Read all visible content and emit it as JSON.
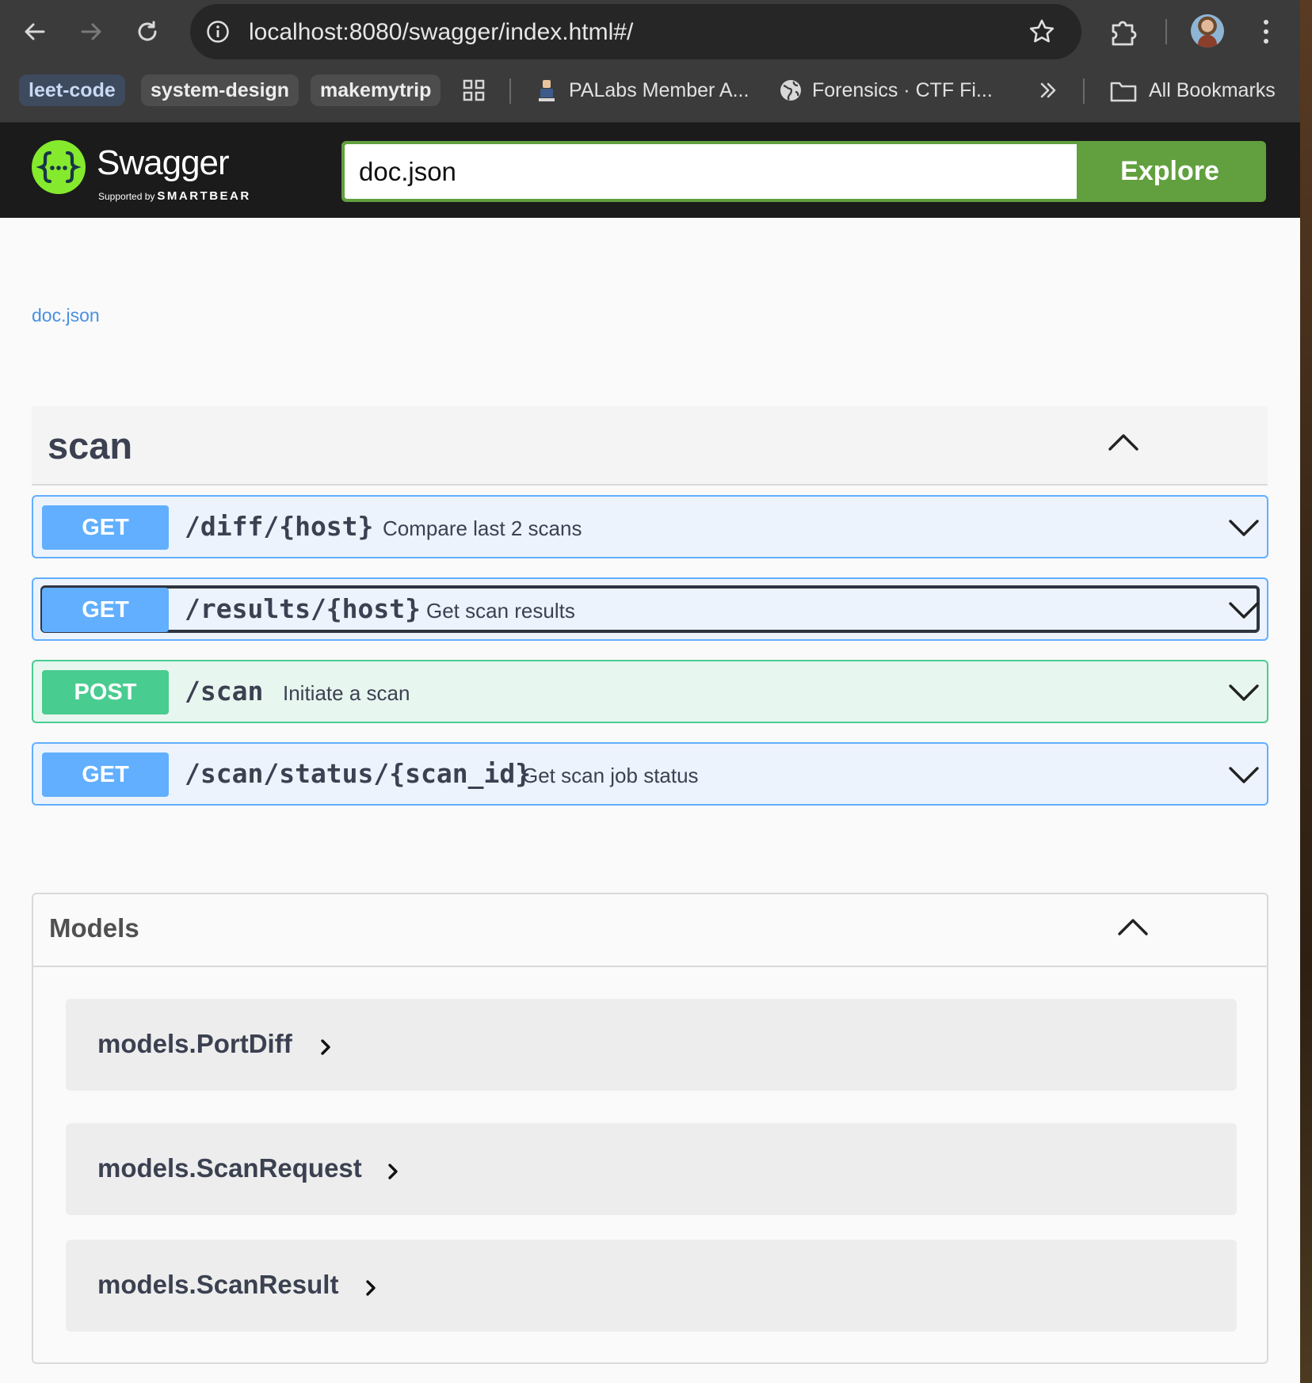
{
  "browser": {
    "url": "localhost:8080/swagger/index.html#/",
    "bookmarks": [
      {
        "label": "leet-code"
      },
      {
        "label": "system-design"
      },
      {
        "label": "makemytrip"
      },
      {
        "label": "PALabs Member A..."
      },
      {
        "label": "Forensics · CTF Fi..."
      }
    ],
    "all_bookmarks_label": "All Bookmarks"
  },
  "topbar": {
    "logo_word": "Swagger",
    "logo_sub_prefix": "Supported by",
    "logo_sub_brand": "SMARTBEAR",
    "spec_url_value": "doc.json",
    "explore_label": "Explore",
    "accent_color": "#62a03f"
  },
  "info": {
    "spec_link": "doc.json"
  },
  "tag": {
    "name": "scan",
    "expanded": true
  },
  "operations": [
    {
      "method": "GET",
      "path": "/diff/{host}",
      "summary": "Compare last 2 scans",
      "color": "#61affe"
    },
    {
      "method": "GET",
      "path": "/results/{host}",
      "summary": "Get scan results",
      "color": "#61affe",
      "focused": true
    },
    {
      "method": "POST",
      "path": "/scan",
      "summary": "Initiate a scan",
      "color": "#49cc90"
    },
    {
      "method": "GET",
      "path": "/scan/status/{scan_id}",
      "summary": "Get scan job status",
      "color": "#61affe"
    }
  ],
  "models": {
    "title": "Models",
    "items": [
      {
        "name": "models.PortDiff"
      },
      {
        "name": "models.ScanRequest"
      },
      {
        "name": "models.ScanResult"
      }
    ]
  }
}
